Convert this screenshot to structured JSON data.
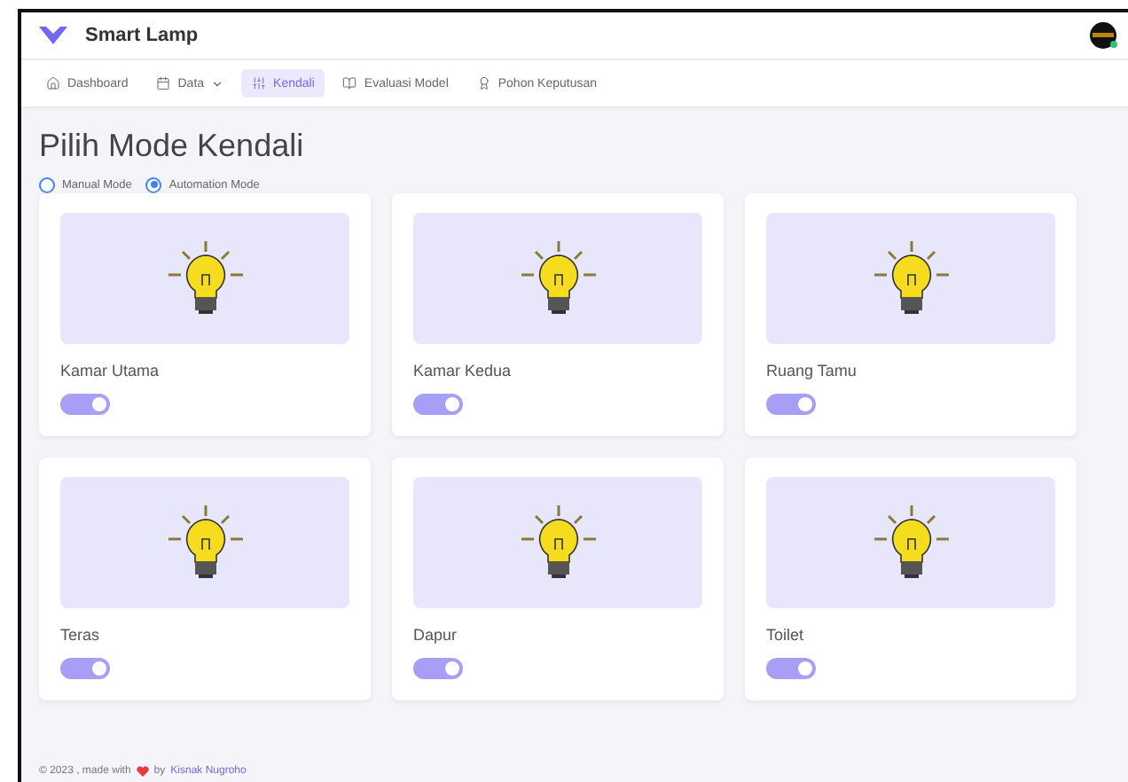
{
  "app": {
    "title": "Smart Lamp"
  },
  "nav": [
    {
      "label": "Dashboard",
      "selected": false,
      "dropdown": false
    },
    {
      "label": "Data",
      "selected": false,
      "dropdown": true
    },
    {
      "label": "Kendali",
      "selected": true,
      "dropdown": false
    },
    {
      "label": "Evaluasi Model",
      "selected": false,
      "dropdown": false
    },
    {
      "label": "Pohon Keputusan",
      "selected": false,
      "dropdown": false
    }
  ],
  "page": {
    "title": "Pilih Mode Kendali"
  },
  "modes": [
    {
      "label": "Manual Mode",
      "selected": false
    },
    {
      "label": "Automation Mode",
      "selected": true
    }
  ],
  "lamps": [
    {
      "name": "Kamar Utama",
      "on": true
    },
    {
      "name": "Kamar Kedua",
      "on": true
    },
    {
      "name": "Ruang Tamu",
      "on": true
    },
    {
      "name": "Teras",
      "on": true
    },
    {
      "name": "Dapur",
      "on": true
    },
    {
      "name": "Toilet",
      "on": true
    }
  ],
  "footer": {
    "prefix": "© 2023 , made with",
    "middle": "by",
    "author": "Kisnak Nugroho"
  }
}
